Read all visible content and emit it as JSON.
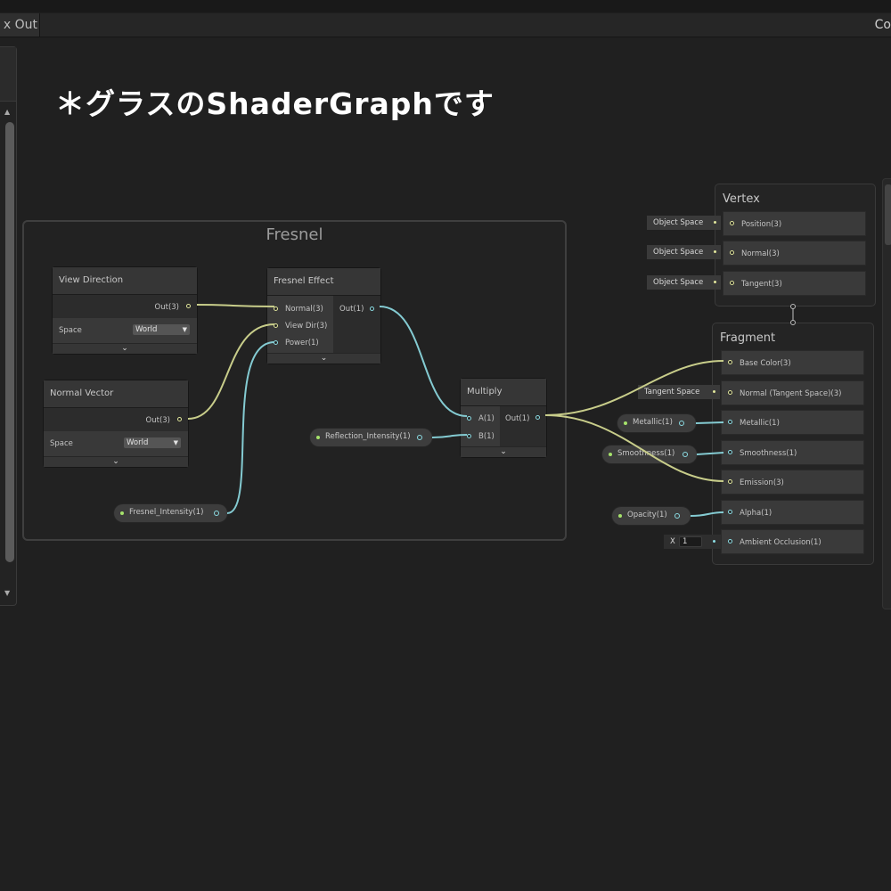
{
  "tabs": {
    "left": "x Out",
    "right": "Co"
  },
  "headline": "＊グラスのShaderGraphです",
  "group": {
    "title": "Fresnel"
  },
  "nodes": {
    "view_direction": {
      "title": "View Direction",
      "out": "Out(3)",
      "space_label": "Space",
      "space_value": "World"
    },
    "normal_vector": {
      "title": "Normal Vector",
      "out": "Out(3)",
      "space_label": "Space",
      "space_value": "World"
    },
    "fresnel_effect": {
      "title": "Fresnel Effect",
      "inputs": [
        "Normal(3)",
        "View Dir(3)",
        "Power(1)"
      ],
      "out": "Out(1)"
    },
    "multiply": {
      "title": "Multiply",
      "inputs": [
        "A(1)",
        "B(1)"
      ],
      "out": "Out(1)"
    }
  },
  "properties": {
    "fresnel_intensity": "Fresnel_Intensity(1)",
    "reflection_intensity": "Reflection_Intensity(1)",
    "metallic": "Metallic(1)",
    "smoothness": "Smoothness(1)",
    "opacity": "Opacity(1)"
  },
  "vertex": {
    "title": "Vertex",
    "blocks": [
      {
        "label": "Position(3)",
        "input": "Object Space"
      },
      {
        "label": "Normal(3)",
        "input": "Object Space"
      },
      {
        "label": "Tangent(3)",
        "input": "Object Space"
      }
    ]
  },
  "fragment": {
    "title": "Fragment",
    "blocks": [
      "Base Color(3)",
      "Normal (Tangent Space)(3)",
      "Metallic(1)",
      "Smoothness(1)",
      "Emission(3)",
      "Alpha(1)",
      "Ambient Occlusion(1)"
    ],
    "normal_input": "Tangent Space",
    "ao_input_label": "X",
    "ao_input_value": "1"
  },
  "colors": {
    "vector_wire": "#c8cd8a",
    "float_wire": "#84cbd2",
    "background": "#202020"
  }
}
